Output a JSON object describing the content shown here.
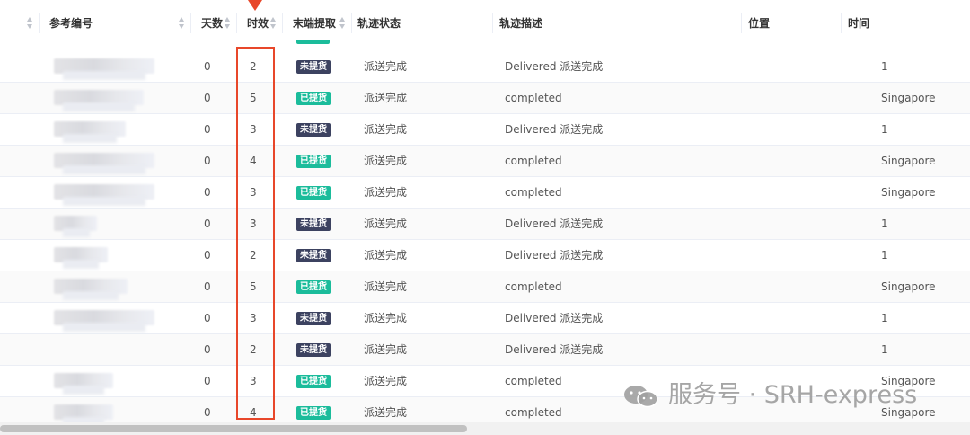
{
  "header": {
    "ref_no": "参考编号",
    "days": "天数",
    "timeliness": "时效",
    "last_mile_pickup": "末端提取",
    "track_status": "轨迹状态",
    "track_desc": "轨迹描述",
    "location": "位置",
    "time": "时间"
  },
  "badges": {
    "picked_up": "已提货",
    "not_picked_up": "未提货"
  },
  "colors": {
    "picked_up": "#1bbc9b",
    "not_picked_up": "#3c4260",
    "highlight": "#e8472a"
  },
  "rows": [
    {
      "days": "0",
      "timeliness": "2",
      "pickup": "未提货",
      "status": "派送完成",
      "desc": "Delivered 派送完成",
      "time": "1"
    },
    {
      "days": "0",
      "timeliness": "5",
      "pickup": "已提货",
      "status": "派送完成",
      "desc": "completed",
      "time": "Singapore"
    },
    {
      "days": "0",
      "timeliness": "3",
      "pickup": "未提货",
      "status": "派送完成",
      "desc": "Delivered 派送完成",
      "time": "1"
    },
    {
      "days": "0",
      "timeliness": "4",
      "pickup": "已提货",
      "status": "派送完成",
      "desc": "completed",
      "time": "Singapore"
    },
    {
      "days": "0",
      "timeliness": "3",
      "pickup": "已提货",
      "status": "派送完成",
      "desc": "completed",
      "time": "Singapore"
    },
    {
      "days": "0",
      "timeliness": "3",
      "pickup": "未提货",
      "status": "派送完成",
      "desc": "Delivered 派送完成",
      "time": "1"
    },
    {
      "days": "0",
      "timeliness": "2",
      "pickup": "未提货",
      "status": "派送完成",
      "desc": "Delivered 派送完成",
      "time": "1"
    },
    {
      "days": "0",
      "timeliness": "5",
      "pickup": "已提货",
      "status": "派送完成",
      "desc": "completed",
      "time": "Singapore"
    },
    {
      "days": "0",
      "timeliness": "3",
      "pickup": "未提货",
      "status": "派送完成",
      "desc": "Delivered 派送完成",
      "time": "1"
    },
    {
      "days": "0",
      "timeliness": "2",
      "pickup": "未提货",
      "status": "派送完成",
      "desc": "Delivered 派送完成",
      "time": "1"
    },
    {
      "days": "0",
      "timeliness": "3",
      "pickup": "已提货",
      "status": "派送完成",
      "desc": "completed",
      "time": "Singapore"
    },
    {
      "days": "0",
      "timeliness": "4",
      "pickup": "已提货",
      "status": "派送完成",
      "desc": "completed",
      "time": "Singapore"
    }
  ],
  "watermark": {
    "text": "服务号 · SRH-express",
    "icon": "wechat-icon"
  }
}
